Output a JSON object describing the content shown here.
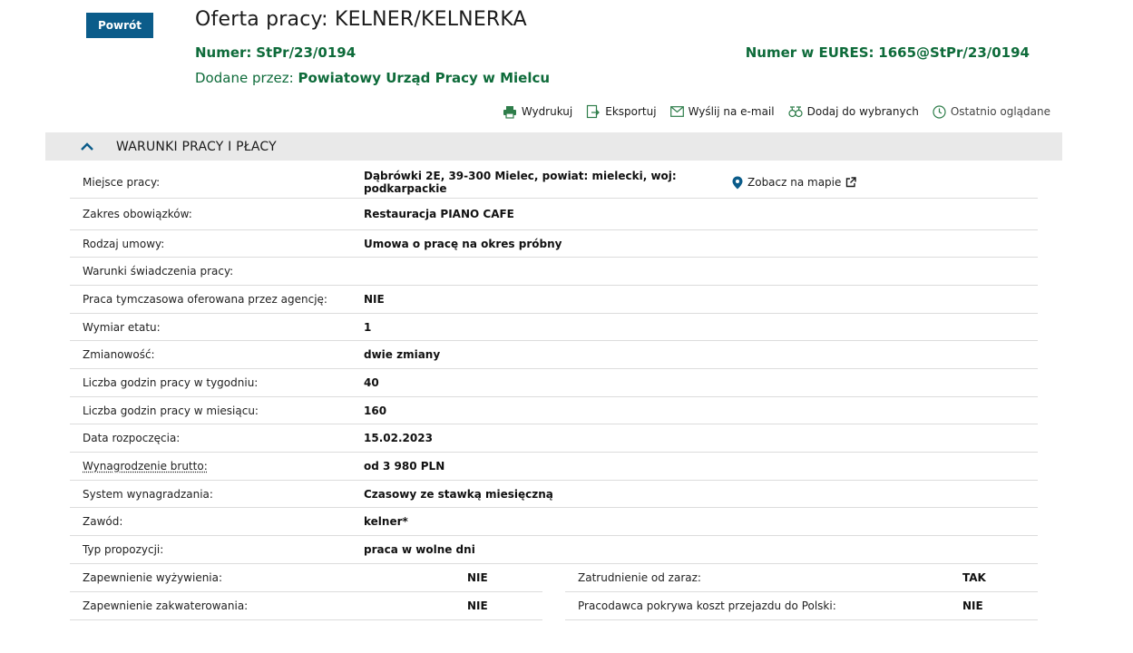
{
  "header": {
    "back_label": "Powrót",
    "title": "Oferta pracy: KELNER/KELNERKA",
    "number_label": "Numer:",
    "number_value": "StPr/23/0194",
    "eures_label": "Numer w EURES:",
    "eures_value": "1665@StPr/23/0194",
    "added_by_label": "Dodane przez:",
    "added_by_value": "Powiatowy Urząd Pracy w Mielcu"
  },
  "toolbar": {
    "print": "Wydrukuj",
    "export": "Eksportuj",
    "email": "Wyślij na e-mail",
    "favorites": "Dodaj do wybranych",
    "recent": "Ostatnio oglądane"
  },
  "section": {
    "title": "WARUNKI PRACY I PŁACY"
  },
  "map_link": "Zobacz na mapie",
  "details": [
    {
      "label": "Miejsce pracy:",
      "value": "Dąbrówki 2E, 39-300 Mielec, powiat: mielecki, woj: podkarpackie"
    },
    {
      "label": "Zakres obowiązków:",
      "value": "Restauracja PIANO CAFE"
    },
    {
      "label": "Rodzaj umowy:",
      "value": "Umowa o pracę na okres próbny"
    },
    {
      "label": "Warunki świadczenia pracy:",
      "value": ""
    },
    {
      "label": "Praca tymczasowa oferowana przez agencję:",
      "value": "NIE"
    },
    {
      "label": "Wymiar etatu:",
      "value": "1"
    },
    {
      "label": "Zmianowość:",
      "value": "dwie zmiany"
    },
    {
      "label": "Liczba godzin pracy w tygodniu:",
      "value": "40"
    },
    {
      "label": "Liczba godzin pracy w miesiącu:",
      "value": "160"
    },
    {
      "label": "Data rozpoczęcia:",
      "value": "15.02.2023"
    },
    {
      "label": "Wynagrodzenie brutto:",
      "value": "od 3 980 PLN"
    },
    {
      "label": "System wynagradzania:",
      "value": "Czasowy ze stawką miesięczną"
    },
    {
      "label": "Zawód:",
      "value": "kelner*"
    },
    {
      "label": "Typ propozycji:",
      "value": "praca w wolne dni"
    }
  ],
  "left_pairs": [
    {
      "label": "Zapewnienie wyżywienia:",
      "value": "NIE"
    },
    {
      "label": "Zapewnienie zakwaterowania:",
      "value": "NIE"
    }
  ],
  "right_pairs": [
    {
      "label": "Zatrudnienie od zaraz:",
      "value": "TAK"
    },
    {
      "label": "Pracodawca pokrywa koszt przejazdu do Polski:",
      "value": "NIE"
    }
  ],
  "colors": {
    "primary": "#0b5c8a",
    "green": "#0e6b3a",
    "section_bg": "#e9e9e9"
  }
}
